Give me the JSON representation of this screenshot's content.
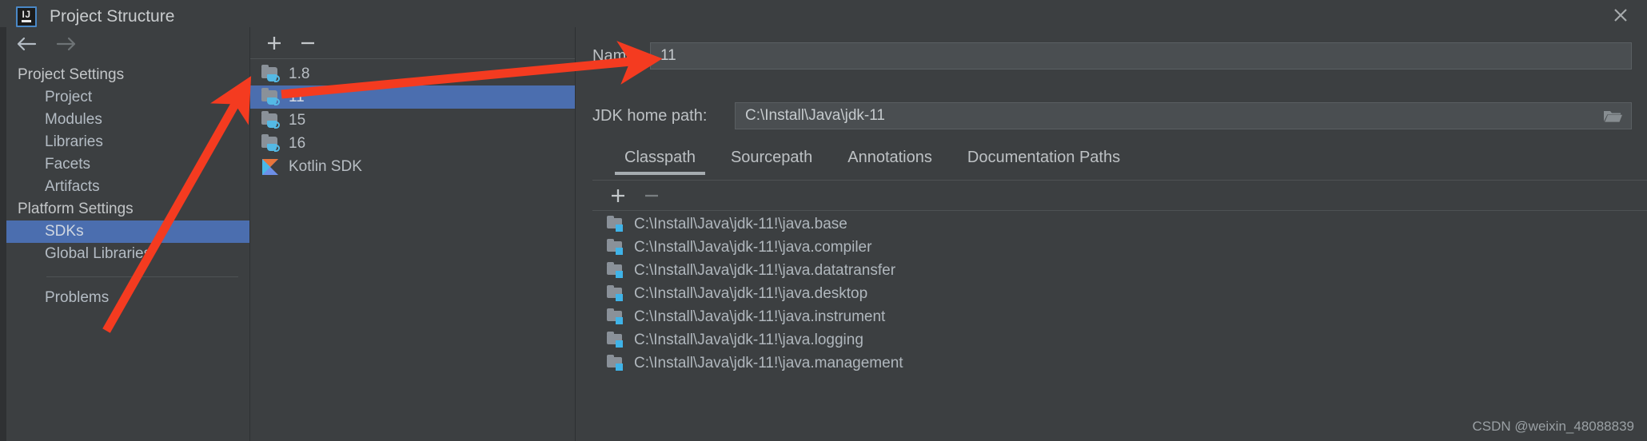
{
  "window": {
    "title": "Project Structure",
    "logo_text": "IJ",
    "close_icon": "close-icon"
  },
  "sidebar": {
    "back_icon": "back-arrow-icon",
    "forward_icon": "forward-arrow-icon",
    "items": [
      {
        "label": "Project Settings",
        "type": "group",
        "selected": false
      },
      {
        "label": "Project",
        "type": "child",
        "selected": false
      },
      {
        "label": "Modules",
        "type": "child",
        "selected": false
      },
      {
        "label": "Libraries",
        "type": "child",
        "selected": false
      },
      {
        "label": "Facets",
        "type": "child",
        "selected": false
      },
      {
        "label": "Artifacts",
        "type": "child",
        "selected": false
      },
      {
        "label": "Platform Settings",
        "type": "group",
        "selected": false
      },
      {
        "label": "SDKs",
        "type": "child",
        "selected": true
      },
      {
        "label": "Global Libraries",
        "type": "child",
        "selected": false
      }
    ],
    "footer_items": [
      {
        "label": "Problems",
        "type": "child",
        "selected": false
      }
    ]
  },
  "sdk_panel": {
    "add_label": "+",
    "remove_label": "−",
    "items": [
      {
        "label": "1.8",
        "icon": "jdk-folder-icon",
        "selected": false
      },
      {
        "label": "11",
        "icon": "jdk-folder-icon",
        "selected": true
      },
      {
        "label": "15",
        "icon": "jdk-folder-icon",
        "selected": false
      },
      {
        "label": "16",
        "icon": "jdk-folder-icon",
        "selected": false
      },
      {
        "label": "Kotlin SDK",
        "icon": "kotlin-sdk-icon",
        "selected": false
      }
    ]
  },
  "detail": {
    "name_label": "Name:",
    "name_value": "11",
    "jdk_home_label": "JDK home path:",
    "jdk_home_value": "C:\\Install\\Java\\jdk-11",
    "browse_icon": "folder-browse-icon",
    "tabs": [
      {
        "label": "Classpath",
        "active": true
      },
      {
        "label": "Sourcepath",
        "active": false
      },
      {
        "label": "Annotations",
        "active": false
      },
      {
        "label": "Documentation Paths",
        "active": false
      }
    ],
    "classpath_toolbar": {
      "add_label": "+",
      "remove_label": "−"
    },
    "classpath_entries": [
      "C:\\Install\\Java\\jdk-11!\\java.base",
      "C:\\Install\\Java\\jdk-11!\\java.compiler",
      "C:\\Install\\Java\\jdk-11!\\java.datatransfer",
      "C:\\Install\\Java\\jdk-11!\\java.desktop",
      "C:\\Install\\Java\\jdk-11!\\java.instrument",
      "C:\\Install\\Java\\jdk-11!\\java.logging",
      "C:\\Install\\Java\\jdk-11!\\java.management"
    ]
  },
  "annotations": {
    "arrow_color": "#f43b20",
    "arrow_count": 2
  },
  "watermark": {
    "text": "CSDN @weixin_48088839"
  },
  "colors": {
    "background": "#3c3f41",
    "selection": "#4b6eaf",
    "field": "#4a4e51",
    "text": "#b8bec4"
  }
}
